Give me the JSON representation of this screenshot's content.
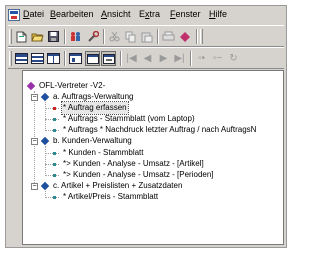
{
  "menu": [
    {
      "first": "D",
      "rest": "atei"
    },
    {
      "first": "B",
      "rest": "earbeiten"
    },
    {
      "first": "A",
      "rest": "nsicht"
    },
    {
      "pre": "E",
      "first": "x",
      "rest": "tra"
    },
    {
      "first": "F",
      "rest": "enster"
    },
    {
      "first": "H",
      "rest": "ilfe"
    }
  ],
  "colors": {
    "root_diamond": "#9933aa",
    "category_diamond": "#1f4f9f",
    "item_dot": "#2a8c8c",
    "active_dot": "#cc2222"
  },
  "tree": {
    "root": "OFL-Vertreter -V2-",
    "a": {
      "label": "a. Auftrags-Verwaltung",
      "items": [
        "* Auftrag erfassen",
        "* Auftrags - Stammblatt (vom Laptop)",
        "* Auftrags * Nachdruck letzter Auftrag / nach AuftragsN"
      ]
    },
    "b": {
      "label": "b. Kunden-Verwaltung",
      "items": [
        "* Kunden - Stammblatt",
        "*> Kunden - Analyse - Umsatz - [Artikel]",
        "*> Kunden - Analyse - Umsatz - [Perioden]"
      ]
    },
    "c": {
      "label": "c. Artikel + Preislisten + Zusatzdaten",
      "items": [
        "* Artikel/Preis - Stammblatt"
      ]
    }
  }
}
